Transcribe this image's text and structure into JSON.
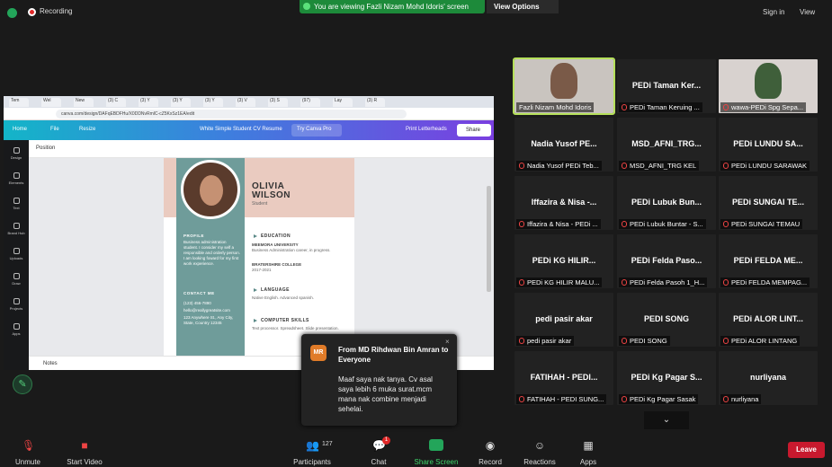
{
  "topbar": {
    "recording": "Recording",
    "banner": "You are viewing Fazli Nizam Mohd Idoris' screen",
    "view_options": "View Options",
    "sign_in": "Sign in",
    "view": "View"
  },
  "browser": {
    "tabs": [
      "Tem",
      "Wel",
      "New",
      "(3) C",
      "(3) Y",
      "(3) Y",
      "(3) Y",
      "(3) V",
      "(3) S",
      "(97)",
      "Lay",
      "(3) R"
    ],
    "url": "canva.com/design/DAFqEBDFHu/X0DDNvRmlC-cZ5KxSz1EA/edit"
  },
  "canva": {
    "home": "Home",
    "file": "File",
    "resize": "Resize",
    "doc_title": "White Simple Student CV Resume",
    "try_pro": "Try Canva Pro",
    "print": "Print Letterheads",
    "share": "Share",
    "position": "Position",
    "notes": "Notes",
    "sidebar": [
      "Design",
      "Elements",
      "Text",
      "Brand Hub",
      "Uploads",
      "Draw",
      "Projects",
      "Apps"
    ]
  },
  "cv": {
    "first": "OLIVIA",
    "last": "WILSON",
    "role": "Student",
    "profile_h": "PROFILE",
    "profile": "Business administration student. I consider my self a responsible and orderly person. I am looking foward for my first work experience.",
    "contact_h": "CONTACT ME",
    "phone": "(123) 456-7890",
    "email": "hello@reallygreatsite.com",
    "address": "123 Anywhere St., Any City, State, Country 12345",
    "edu_h": "EDUCATION",
    "uni": "MEEMORA UNIVERSITY",
    "uni_d": "Business Administration career, in progress.",
    "college": "BRATERSHIRE COLLEGE",
    "college_d": "2017-2021",
    "lang_h": "LANGUAGE",
    "lang": "Native English. Advanced spanish.",
    "skills_h": "COMPUTER SKILLS",
    "skills": "Text processor. Spreadsheet. Slide presentation."
  },
  "popup": {
    "avatar": "MR",
    "from": "From MD Rihdwan Bin Amran to Everyone",
    "message": "Maaf saya nak tanya. Cv asal saya lebih 6 muka surat.mcm mana nak combine menjadi sehelai.",
    "close": "×"
  },
  "gallery": [
    {
      "name": "",
      "label": "Fazli Nizam Mohd Idoris",
      "video": true,
      "muted": false,
      "active": true
    },
    {
      "name": "PEDi Taman Ker...",
      "label": "PEDi Taman Keruing ...",
      "video": false,
      "muted": true
    },
    {
      "name": "",
      "label": "wawa-PEDi Spg Sepa...",
      "video": true,
      "muted": true
    },
    {
      "name": "Nadia Yusof PE...",
      "label": "Nadia Yusof PEDi Teb...",
      "video": false,
      "muted": true
    },
    {
      "name": "MSD_AFNI_TRG...",
      "label": "MSD_AFNI_TRG KEL",
      "video": false,
      "muted": true
    },
    {
      "name": "PEDi LUNDU SA...",
      "label": "PEDi LUNDU SARAWAK",
      "video": false,
      "muted": true
    },
    {
      "name": "Iffazira & Nisa -...",
      "label": "Iffazira & Nisa - PEDi ...",
      "video": false,
      "muted": true
    },
    {
      "name": "PEDi Lubuk Bun...",
      "label": "PEDi Lubuk Buntar - S...",
      "video": false,
      "muted": true
    },
    {
      "name": "PEDi SUNGAI TE...",
      "label": "PEDi SUNGAI TEMAU",
      "video": false,
      "muted": true
    },
    {
      "name": "PEDi KG HILIR...",
      "label": "PEDi KG HILIR MALU...",
      "video": false,
      "muted": true
    },
    {
      "name": "PEDi Felda Paso...",
      "label": "PEDi Felda Pasoh 1_H...",
      "video": false,
      "muted": true
    },
    {
      "name": "PEDi FELDA ME...",
      "label": "PEDi FELDA MEMPAG...",
      "video": false,
      "muted": true
    },
    {
      "name": "pedi pasir akar",
      "label": "pedi pasir akar",
      "video": false,
      "muted": true
    },
    {
      "name": "PEDI SONG",
      "label": "PEDI SONG",
      "video": false,
      "muted": true
    },
    {
      "name": "PEDi ALOR LINT...",
      "label": "PEDi ALOR LINTANG",
      "video": false,
      "muted": true
    },
    {
      "name": "FATIHAH - PEDI...",
      "label": "FATIHAH - PEDI SUNG...",
      "video": false,
      "muted": true
    },
    {
      "name": "PEDi Kg Pagar S...",
      "label": "PEDi Kg Pagar Sasak",
      "video": false,
      "muted": true
    },
    {
      "name": "nurliyana",
      "label": "nurliyana",
      "video": false,
      "muted": true
    }
  ],
  "toolbar": {
    "unmute": "Unmute",
    "start_video": "Start Video",
    "participants": "Participants",
    "participants_count": "127",
    "chat": "Chat",
    "chat_badge": "1",
    "share_screen": "Share Screen",
    "record": "Record",
    "reactions": "Reactions",
    "apps": "Apps",
    "leave": "Leave"
  }
}
